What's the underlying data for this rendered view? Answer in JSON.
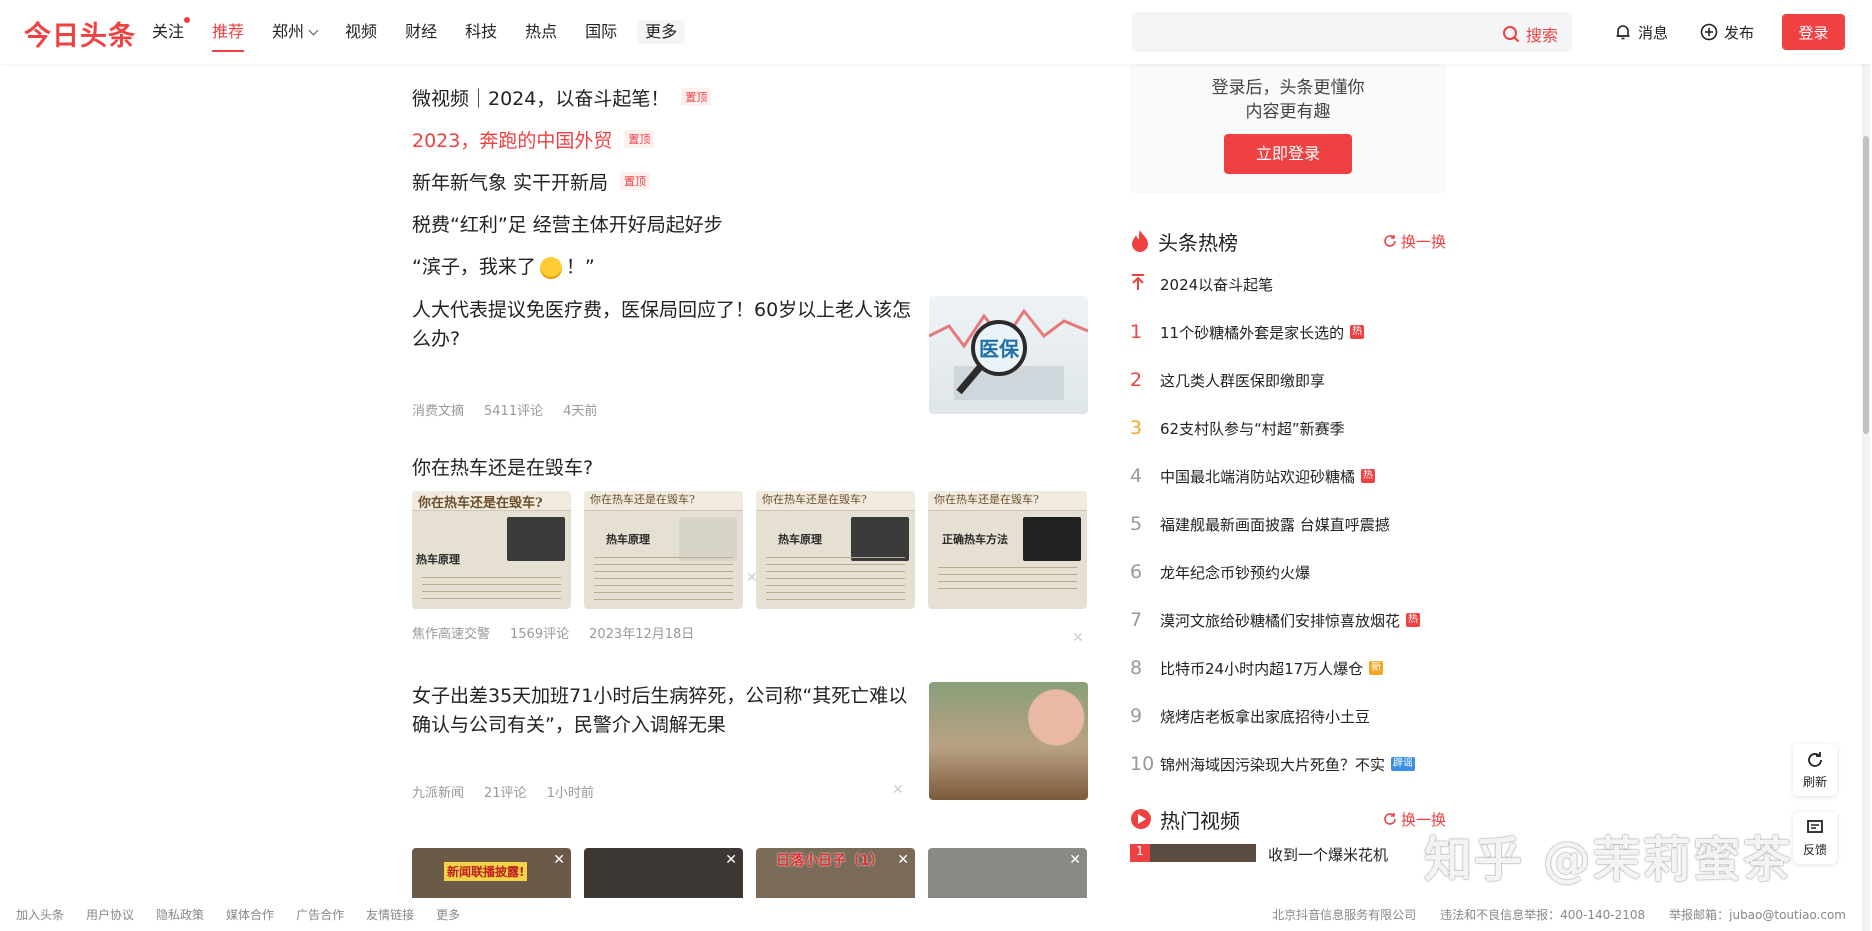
{
  "header": {
    "logo": "今日头条",
    "nav": [
      "关注",
      "推荐",
      "郑州",
      "视频",
      "财经",
      "科技",
      "热点",
      "国际",
      "更多"
    ],
    "search_placeholder": "",
    "search_label": "搜索",
    "message_label": "消息",
    "publish_label": "发布",
    "login_label": "登录",
    "colors": {
      "brand": "#f04142"
    }
  },
  "pinned": [
    {
      "title": "微视频｜2024，以奋斗起笔！",
      "tag": "置顶",
      "red": false
    },
    {
      "title": "2023，奔跑的中国外贸",
      "tag": "置顶",
      "red": true
    },
    {
      "title": "新年新气象 实干开新局",
      "tag": "置顶",
      "red": false
    },
    {
      "title": "税费“红利”足 经营主体开好局起好步",
      "tag": "",
      "red": false
    },
    {
      "title_prefix": "“滨子，我来了",
      "title_suffix": "！”",
      "tag": "",
      "red": false,
      "icon": "star-eyes-emoji-icon"
    }
  ],
  "articles": [
    {
      "title": "人大代表提议免医疗费，医保局回应了！60岁以上老人该怎么办?",
      "source": "消费文摘",
      "comments": "5411评论",
      "time": "4天前",
      "thumb_text": "医保"
    },
    {
      "title": "你在热车还是在毁车?",
      "source": "焦作高速交警",
      "comments": "1569评论",
      "time": "2023年12月18日",
      "tiles": [
        {
          "top": "你在热车还是在毁车?",
          "label": "热车原理"
        },
        {
          "top": "你在热车还是在毁车?",
          "label": "热车原理"
        },
        {
          "top": "你在热车还是在毁车?",
          "label": "热车原理"
        },
        {
          "top": "你在热车还是在毁车?",
          "label": "正确热车方法"
        }
      ]
    },
    {
      "title": "女子出差35天加班71小时后生病猝死，公司称“其死亡难以确认与公司有关”，民警介入调解无果",
      "source": "九派新闻",
      "comments": "21评论",
      "time": "1小时前"
    },
    {
      "video_tiles": [
        "新闻联播披露!",
        "",
        "日落小日子（1）",
        ""
      ]
    }
  ],
  "sidebar": {
    "login_text_1": "登录后，头条更懂你",
    "login_text_2": "内容更有趣",
    "login_button": "立即登录",
    "hot_title": "头条热榜",
    "refresh_label": "换一换",
    "hot_items": [
      {
        "rank": "",
        "title": "2024以奋斗起笔",
        "badge": "",
        "pinned": true
      },
      {
        "rank": "1",
        "title": "11个砂糖橘外套是家长选的",
        "badge": "热"
      },
      {
        "rank": "2",
        "title": "这几类人群医保即缴即享",
        "badge": ""
      },
      {
        "rank": "3",
        "title": "62支村队参与“村超”新赛季",
        "badge": ""
      },
      {
        "rank": "4",
        "title": "中国最北端消防站欢迎砂糖橘",
        "badge": "热"
      },
      {
        "rank": "5",
        "title": "福建舰最新画面披露 台媒直呼震撼",
        "badge": ""
      },
      {
        "rank": "6",
        "title": "龙年纪念币钞预约火爆",
        "badge": ""
      },
      {
        "rank": "7",
        "title": "漠河文旅给砂糖橘们安排惊喜放烟花",
        "badge": "热"
      },
      {
        "rank": "8",
        "title": "比特币24小时内超17万人爆仓",
        "badge": "新"
      },
      {
        "rank": "9",
        "title": "烧烤店老板拿出家底招待小土豆",
        "badge": ""
      },
      {
        "rank": "10",
        "title": "锦州海域因污染现大片死鱼？不实",
        "badge": "辟谣"
      }
    ],
    "video_title": "热门视频",
    "video_refresh": "换一换",
    "video_first": {
      "num": "1",
      "title": "收到一个爆米花机"
    }
  },
  "float": {
    "refresh": "刷新",
    "feedback": "反馈"
  },
  "footer": {
    "left": [
      "加入头条",
      "用户协议",
      "隐私政策",
      "媒体合作",
      "广告合作",
      "友情链接",
      "更多"
    ],
    "right": [
      "北京抖音信息服务有限公司",
      "违法和不良信息举报：400-140-2108",
      "举报邮箱：jubao@toutiao.com"
    ]
  },
  "watermark": "知乎 @茉莉蜜茶"
}
